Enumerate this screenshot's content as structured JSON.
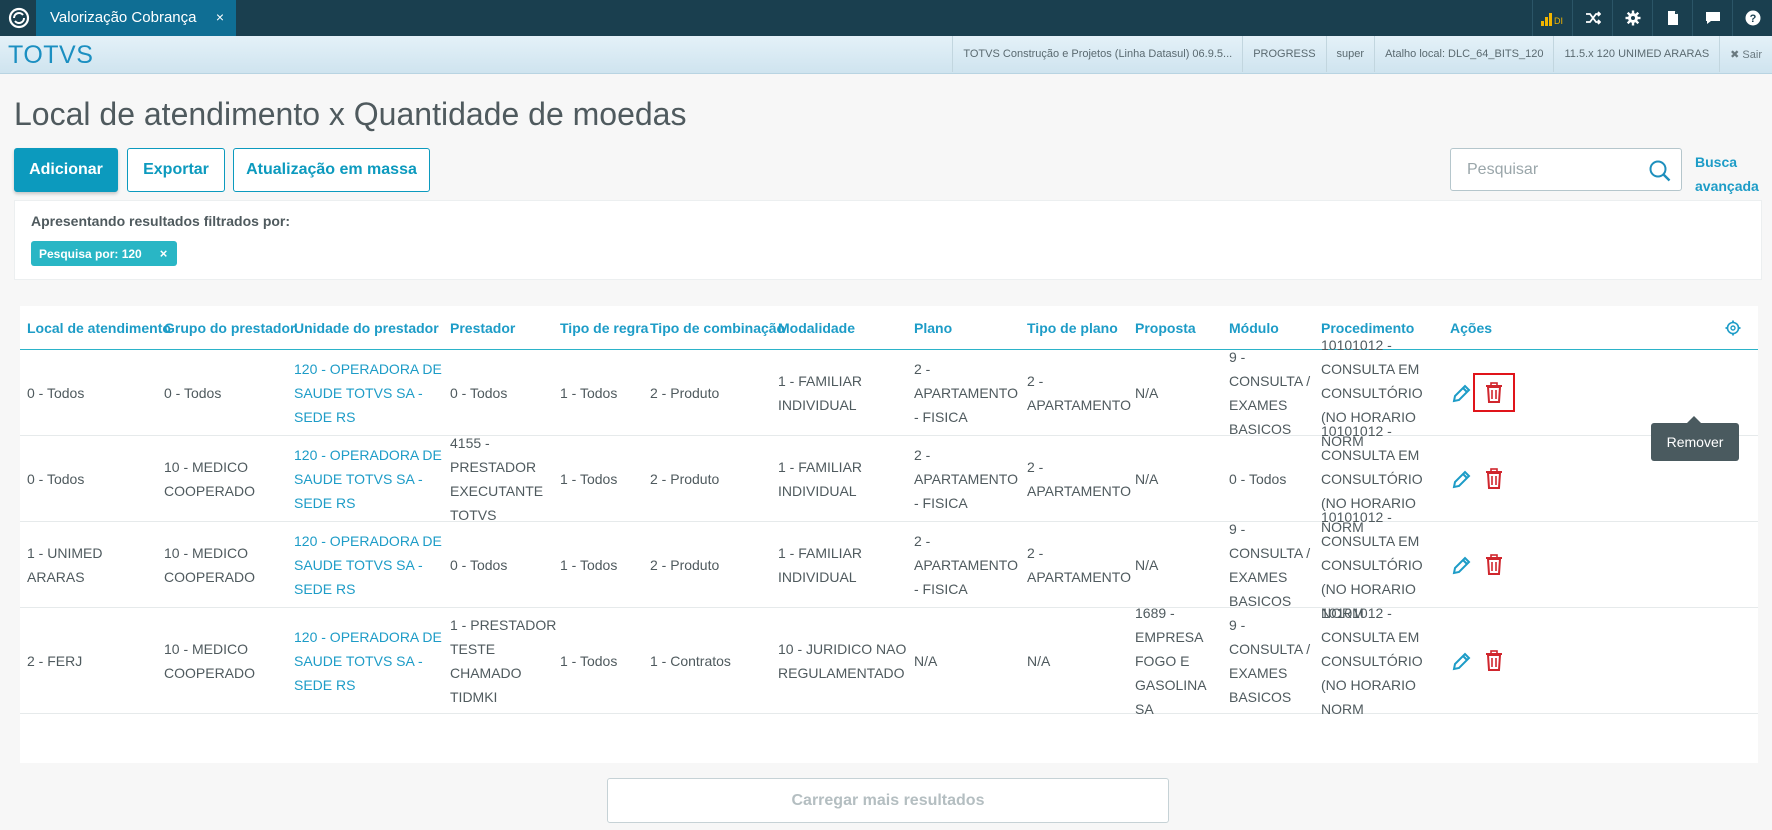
{
  "window": {
    "tab_title": "Valorização Cobrança",
    "tab_close": "×"
  },
  "header": {
    "brand": "TOTVS",
    "info": [
      "TOTVS Construção e Projetos (Linha Datasul) 06.9.5...",
      "PROGRESS",
      "super",
      "Atalho local: DLC_64_BITS_120",
      "11.5.x 120 UNIMED ARARAS"
    ],
    "logout_label": "✖ Sair",
    "top_icons": [
      "signal-icon",
      "shuffle-icon",
      "gear-icon",
      "document-icon",
      "chat-icon",
      "help-icon"
    ],
    "signal_label": "DI"
  },
  "page": {
    "title": "Local de atendimento x Quantidade de moedas"
  },
  "toolbar": {
    "add_label": "Adicionar",
    "export_label": "Exportar",
    "bulk_update_label": "Atualização em massa"
  },
  "search": {
    "placeholder": "Pesquisar",
    "advanced_line1": "Busca",
    "advanced_line2": "avançada"
  },
  "filters": {
    "label": "Apresentando resultados filtrados por:",
    "chips": [
      {
        "text": "Pesquisa por: 120",
        "remove": "×"
      }
    ]
  },
  "table": {
    "columns": [
      "Local de atendimento",
      "Grupo do prestador",
      "Unidade do prestador",
      "Prestador",
      "Tipo de regra",
      "Tipo de combinação",
      "Modalidade",
      "Plano",
      "Tipo de plano",
      "Proposta",
      "Módulo",
      "Procedimento",
      "Ações"
    ],
    "rows": [
      [
        "0 - Todos",
        "0 - Todos",
        "120 - OPERADORA DE SAUDE TOTVS SA - SEDE RS",
        "0 - Todos",
        "1 - Todos",
        "2 - Produto",
        "1 - FAMILIAR INDIVIDUAL",
        "2 - APARTAMENTO - FISICA",
        "2 - APARTAMENTO",
        "N/A",
        "9 - CONSULTA / EXAMES BASICOS",
        "10101012 - CONSULTA EM CONSULTÓRIO (NO HORARIO NORM"
      ],
      [
        "0 - Todos",
        "10 - MEDICO COOPERADO",
        "120 - OPERADORA DE SAUDE TOTVS SA - SEDE RS",
        "4155 - PRESTADOR EXECUTANTE TOTVS",
        "1 - Todos",
        "2 - Produto",
        "1 - FAMILIAR INDIVIDUAL",
        "2 - APARTAMENTO - FISICA",
        "2 - APARTAMENTO",
        "N/A",
        "0 - Todos",
        "10101012 - CONSULTA EM CONSULTÓRIO (NO HORARIO NORM"
      ],
      [
        "1 - UNIMED ARARAS",
        "10 - MEDICO COOPERADO",
        "120 - OPERADORA DE SAUDE TOTVS SA - SEDE RS",
        "0 - Todos",
        "1 - Todos",
        "2 - Produto",
        "1 - FAMILIAR INDIVIDUAL",
        "2 - APARTAMENTO - FISICA",
        "2 - APARTAMENTO",
        "N/A",
        "9 - CONSULTA / EXAMES BASICOS",
        "10101012 - CONSULTA EM CONSULTÓRIO (NO HORARIO NORM"
      ],
      [
        "2 - FERJ",
        "10 - MEDICO COOPERADO",
        "120 - OPERADORA DE SAUDE TOTVS SA - SEDE RS",
        "1 - PRESTADOR TESTE CHAMADO TIDMKI",
        "1 - Todos",
        "1 - Contratos",
        "10 - JURIDICO NAO REGULAMENTADO",
        "N/A",
        "N/A",
        "1689 - EMPRESA FOGO E GASOLINA SA",
        "9 - CONSULTA / EXAMES BASICOS",
        "10101012 - CONSULTA EM CONSULTÓRIO (NO HORARIO NORM"
      ]
    ],
    "tooltip": "Remover",
    "load_more_label": "Carregar mais resultados"
  },
  "colors": {
    "topbar": "#1a3f4f",
    "accent": "#0c9abe",
    "link": "#1d9cc7",
    "chip": "#29b6c5",
    "danger": "#d0262d",
    "highlight": "#e0141a"
  }
}
